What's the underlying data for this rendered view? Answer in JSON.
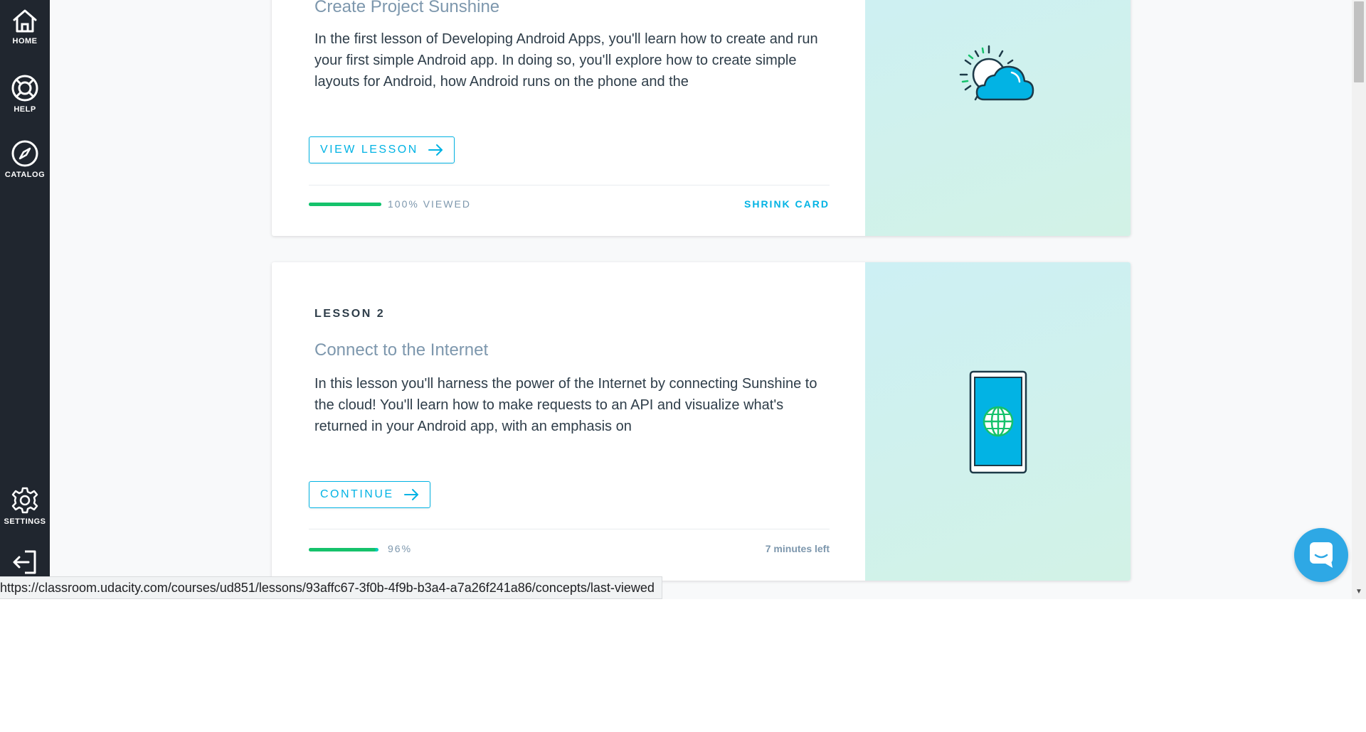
{
  "sidebar": {
    "items": [
      {
        "label": "HOME",
        "icon": "home-icon"
      },
      {
        "label": "HELP",
        "icon": "lifebuoy-icon"
      },
      {
        "label": "CATALOG",
        "icon": "compass-icon"
      },
      {
        "label": "SETTINGS",
        "icon": "gear-icon"
      },
      {
        "label": "",
        "icon": "logout-icon"
      }
    ]
  },
  "lessons": [
    {
      "label": "",
      "title": "Create Project Sunshine",
      "description": "In the first lesson of Developing Android Apps, you'll learn how to create and run your first simple Android app. In doing so, you'll explore how to create simple layouts for Android, how Android runs on the phone and the",
      "button_label": "VIEW LESSON",
      "progress_percent": 100,
      "progress_text": "100% VIEWED",
      "right_action": "SHRINK CARD",
      "art_icon": "sun-cloud-icon"
    },
    {
      "label": "LESSON 2",
      "title": "Connect to the Internet",
      "description": "In this lesson you'll harness the power of the Internet by connecting Sunshine to the cloud! You'll learn how to make requests to an API and visualize what's returned in your Android app, with an emphasis on",
      "button_label": "CONTINUE",
      "progress_percent": 96,
      "progress_text": "96%",
      "time_left": "7 minutes left",
      "art_icon": "phone-globe-icon"
    }
  ],
  "status_bar": {
    "url": "https://classroom.udacity.com/courses/ud851/lessons/93affc67-3f0b-4f9b-b3a4-a7a26f241a86/concepts/last-viewed"
  },
  "colors": {
    "sidebar_bg": "#20262f",
    "accent": "#02b3e4",
    "progress": "#15c26b",
    "title": "#7d97ad",
    "text": "#2e3d49"
  }
}
